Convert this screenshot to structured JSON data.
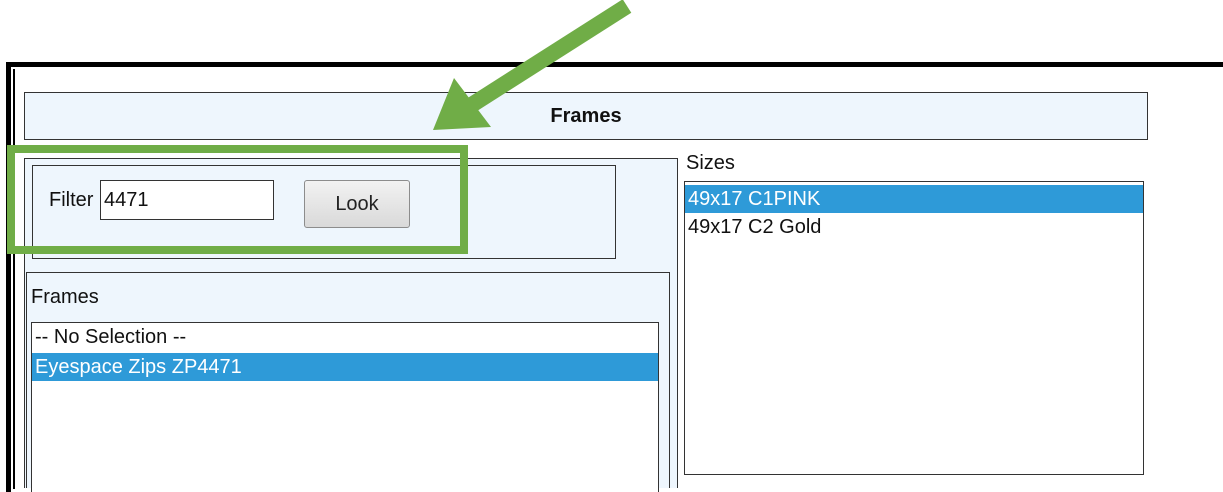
{
  "header": {
    "title": "Frames"
  },
  "filter": {
    "label": "Filter",
    "value": "4471",
    "button_label": "Look"
  },
  "frames": {
    "label": "Frames",
    "items": [
      {
        "label": "-- No Selection --",
        "selected": false
      },
      {
        "label": "Eyespace Zips ZP4471",
        "selected": true
      }
    ]
  },
  "sizes": {
    "label": "Sizes",
    "items": [
      {
        "label": "49x17 C1PINK",
        "selected": true
      },
      {
        "label": "49x17 C2 Gold",
        "selected": false
      }
    ]
  },
  "colors": {
    "highlight": "#70ad47",
    "selection": "#2e9ad8",
    "panel": "#eef6fd"
  }
}
